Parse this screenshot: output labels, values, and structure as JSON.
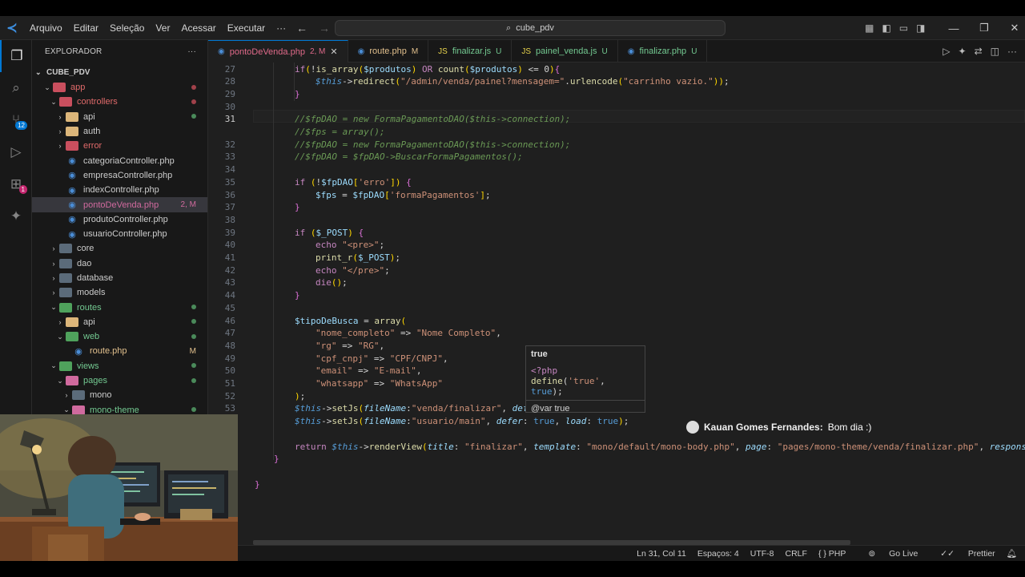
{
  "menu": [
    "Arquivo",
    "Editar",
    "Seleção",
    "Ver",
    "Acessar",
    "Executar",
    "···"
  ],
  "command_center": "cube_pdv",
  "sidebar": {
    "title": "EXPLORADOR",
    "more": "···",
    "root": "CUBE_PDV",
    "items": [
      {
        "label": "app",
        "depth": 1,
        "kind": "folder-r",
        "open": true,
        "status": "dot-red"
      },
      {
        "label": "controllers",
        "depth": 2,
        "kind": "folder-r",
        "open": true,
        "status": "dot-red"
      },
      {
        "label": "api",
        "depth": 3,
        "kind": "folder-y",
        "open": false,
        "status": "dot-green"
      },
      {
        "label": "auth",
        "depth": 3,
        "kind": "folder-y",
        "open": false,
        "status": ""
      },
      {
        "label": "error",
        "depth": 3,
        "kind": "folder-r",
        "open": false,
        "status": ""
      },
      {
        "label": "categoriaController.php",
        "depth": 3,
        "kind": "php",
        "status": ""
      },
      {
        "label": "empresaController.php",
        "depth": 3,
        "kind": "php",
        "status": ""
      },
      {
        "label": "indexController.php",
        "depth": 3,
        "kind": "php",
        "status": ""
      },
      {
        "label": "pontoDeVenda.php",
        "depth": 3,
        "kind": "php",
        "status": "2, M",
        "selected": true
      },
      {
        "label": "produtoController.php",
        "depth": 3,
        "kind": "php",
        "status": ""
      },
      {
        "label": "usuarioController.php",
        "depth": 3,
        "kind": "php",
        "status": ""
      },
      {
        "label": "core",
        "depth": 2,
        "kind": "folder-dk",
        "open": false,
        "status": ""
      },
      {
        "label": "dao",
        "depth": 2,
        "kind": "folder-dk",
        "open": false,
        "status": ""
      },
      {
        "label": "database",
        "depth": 2,
        "kind": "folder-dk",
        "open": false,
        "status": ""
      },
      {
        "label": "models",
        "depth": 2,
        "kind": "folder-dk",
        "open": false,
        "status": ""
      },
      {
        "label": "routes",
        "depth": 2,
        "kind": "folder-g",
        "open": true,
        "status": "dot-green"
      },
      {
        "label": "api",
        "depth": 3,
        "kind": "folder-y",
        "open": false,
        "status": "dot-green"
      },
      {
        "label": "web",
        "depth": 3,
        "kind": "folder-g",
        "open": true,
        "status": "dot-green"
      },
      {
        "label": "route.php",
        "depth": 4,
        "kind": "php",
        "status": "M"
      },
      {
        "label": "views",
        "depth": 2,
        "kind": "folder-g",
        "open": true,
        "status": "dot-green"
      },
      {
        "label": "pages",
        "depth": 3,
        "kind": "folder-p",
        "open": true,
        "status": "dot-green"
      },
      {
        "label": "mono",
        "depth": 4,
        "kind": "folder-dk",
        "open": false,
        "status": ""
      },
      {
        "label": "mono-theme",
        "depth": 4,
        "kind": "folder-p",
        "open": true,
        "status": "dot-green"
      }
    ]
  },
  "tabs": [
    {
      "label": "pontoDeVenda.php",
      "state": "2, M",
      "icon": "php",
      "active": true
    },
    {
      "label": "route.php",
      "state": "M",
      "icon": "php"
    },
    {
      "label": "finalizar.js",
      "state": "U",
      "icon": "js"
    },
    {
      "label": "painel_venda.js",
      "state": "U",
      "icon": "js"
    },
    {
      "label": "finalizar.php",
      "state": "U",
      "icon": "php"
    }
  ],
  "line_numbers": [
    "27",
    "28",
    "29",
    "30",
    "31",
    "",
    "32",
    "33",
    "34",
    "35",
    "36",
    "37",
    "38",
    "39",
    "40",
    "41",
    "42",
    "43",
    "44",
    "45",
    "46",
    "47",
    "48",
    "49",
    "50",
    "51",
    "52",
    "53",
    "",
    "",
    "",
    "",
    ""
  ],
  "code_lines": [
    "if(!is_array($produtos) OR count($produtos) <= 0){",
    "    $this->redirect(\"/admin/venda/painel?mensagem=\".urlencode(\"carrinho vazio.\"));",
    "}",
    "",
    "//$fpDAO = new FormaPagamentoDAO($this->connection);",
    "//$fps = array();",
    "//$fpDAO = new FormaPagamentoDAO($this->connection);",
    "//$fpDAO = $fpDAO->BuscarFormaPagamentos();",
    "",
    "if (!$fpDAO['erro']) {",
    "    $fps = $fpDAO['formaPagamentos'];",
    "}",
    "",
    "if ($_POST) {",
    "    echo \"<pre>\";",
    "    print_r($_POST);",
    "    echo \"</pre>\";",
    "    die();",
    "}",
    "",
    "$tipoDeBusca = array(",
    "    \"nome_completo\" => \"Nome Completo\",",
    "    \"rg\" => \"RG\",",
    "    \"cpf_cnpj\" => \"CPF/CNPJ\",",
    "    \"email\" => \"E-mail\",",
    "    \"whatsapp\" => \"WhatsApp\"",
    ");",
    "$this->setJs(fileName:\"venda/finalizar\", defer: true, load: true);",
    "$this->setJs(fileName:\"usuario/main\", defer: true, load: true);",
    "",
    "return $this->renderView(title: \"finalizar\", template: \"mono/default/mono-body.php\", page: \"pages/mono-theme/venda/finalizar.php\", response:",
    "}",
    "",
    "}"
  ],
  "hover": {
    "title": "true",
    "line1": "<?php",
    "line2": "define('true', true);",
    "line3": "@var true"
  },
  "chat": {
    "name": "Kauan Gomes Fernandes:",
    "message": "Bom dia :)"
  },
  "status": {
    "position": "Ln 31, Col 11",
    "spaces": "Espaços: 4",
    "encoding": "UTF-8",
    "eol": "CRLF",
    "language": "{ } PHP",
    "golive": "Go Live",
    "prettier": "Prettier"
  }
}
